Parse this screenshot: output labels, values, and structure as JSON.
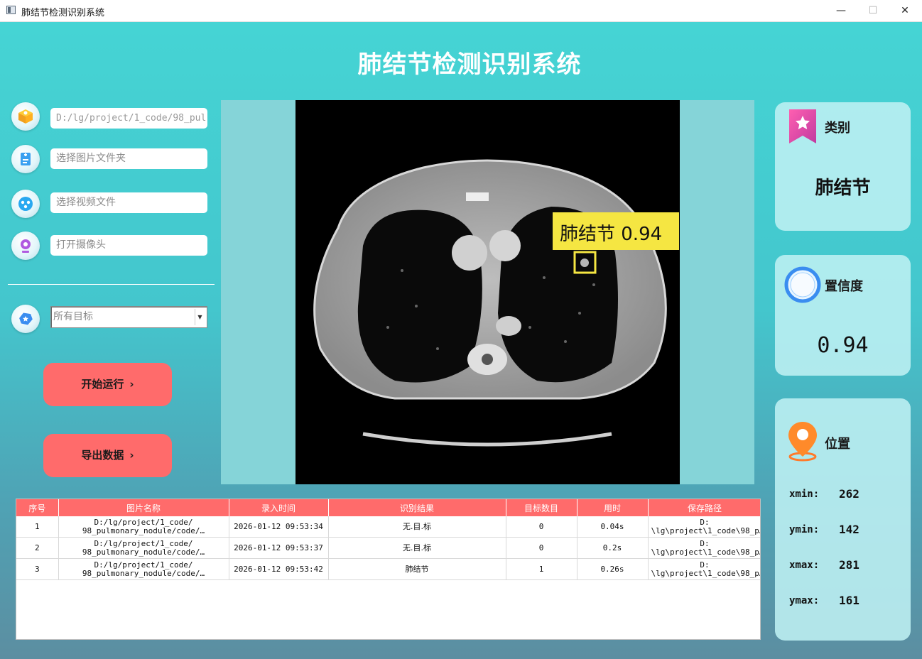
{
  "window": {
    "title": "肺结节检测识别系统",
    "minimize": "—",
    "maximize": "☐",
    "close": "✕"
  },
  "app_title": "肺结节检测识别系统",
  "inputs": {
    "image_path": "D:/lg/project/1_code/98_pul",
    "folder_placeholder": "选择图片文件夹",
    "video_placeholder": "选择视频文件",
    "camera_placeholder": "打开摄像头"
  },
  "target_select": {
    "selected": "所有目标"
  },
  "buttons": {
    "run": "开始运行",
    "export": "导出数据"
  },
  "detection_overlay": {
    "label": "肺结节 0.94"
  },
  "result": {
    "category_title": "类别",
    "category_value": "肺结节",
    "confidence_title": "置信度",
    "confidence_value": "0.94",
    "position_title": "位置",
    "xmin_label": "xmin:",
    "xmin": "262",
    "ymin_label": "ymin:",
    "ymin": "142",
    "xmax_label": "xmax:",
    "xmax": "281",
    "ymax_label": "ymax:",
    "ymax": "161"
  },
  "table": {
    "headers": [
      "序号",
      "图片名称",
      "录入时间",
      "识别结果",
      "目标数目",
      "用时",
      "保存路径"
    ],
    "rows": [
      [
        "1",
        "D:/lg/project/1_code/\n98_pulmonary_nodule/code/…",
        "2026-01-12 09:53:34",
        "无.目.标",
        "0",
        "0.04s",
        "D:\n\\lg\\project\\1_code\\98_p…"
      ],
      [
        "2",
        "D:/lg/project/1_code/\n98_pulmonary_nodule/code/…",
        "2026-01-12 09:53:37",
        "无.目.标",
        "0",
        "0.2s",
        "D:\n\\lg\\project\\1_code\\98_p…"
      ],
      [
        "3",
        "D:/lg/project/1_code/\n98_pulmonary_nodule/code/…",
        "2026-01-12 09:53:42",
        "肺结节",
        "1",
        "0.26s",
        "D:\n\\lg\\project\\1_code\\98_p…"
      ]
    ]
  },
  "colors": {
    "accent_button": "#ff6b6b",
    "detection_box": "#f5e642",
    "header_bg": "#ff6b6b"
  }
}
